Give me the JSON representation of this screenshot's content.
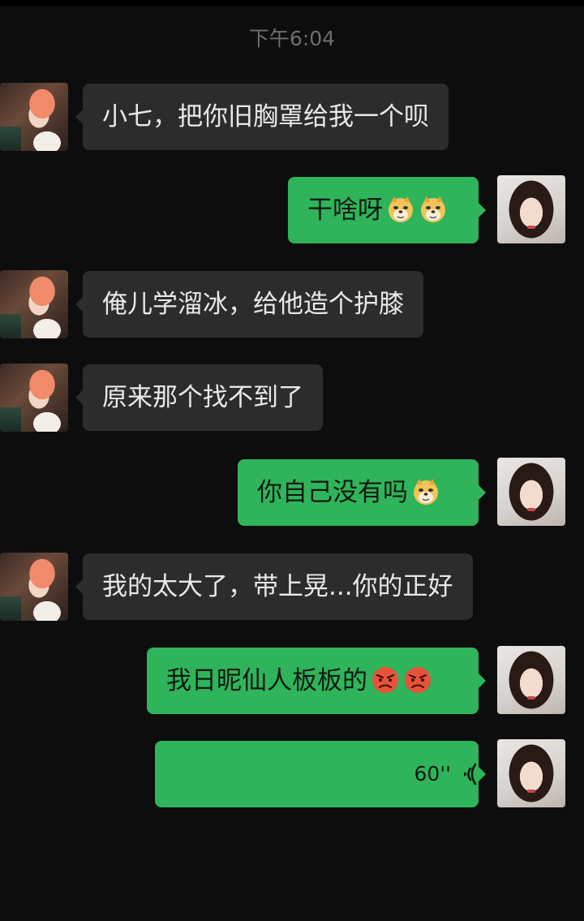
{
  "timestamp": "下午6:04",
  "messages": [
    {
      "side": "recv",
      "text": "小七，把你旧胸罩给我一个呗"
    },
    {
      "side": "sent",
      "text": "干啥呀",
      "emojis": [
        "doge-icon",
        "doge-icon"
      ]
    },
    {
      "side": "recv",
      "text": "俺儿学溜冰，给他造个护膝"
    },
    {
      "side": "recv",
      "text": "原来那个找不到了"
    },
    {
      "side": "sent",
      "text": "你自己没有吗",
      "emojis": [
        "doge-icon"
      ]
    },
    {
      "side": "recv",
      "text": "我的太大了，带上晃...你的正好"
    },
    {
      "side": "sent",
      "text": "我日昵仙人板板的",
      "emojis": [
        "angry-face-icon",
        "angry-face-icon"
      ]
    },
    {
      "side": "sent",
      "type": "voice",
      "duration": "60''"
    }
  ],
  "colors": {
    "background": "#0d0d0d",
    "received_bubble": "#2c2c2c",
    "sent_bubble": "#2fb45b",
    "timestamp_text": "#6e6e6e"
  }
}
